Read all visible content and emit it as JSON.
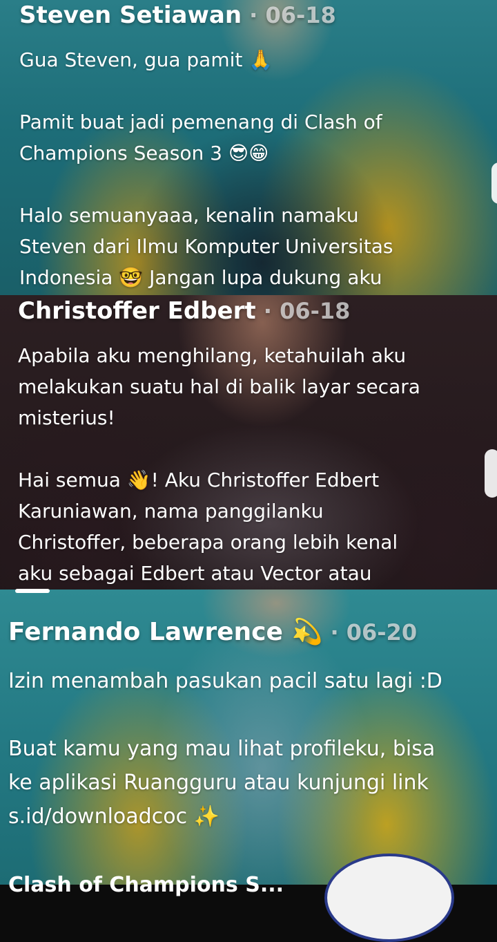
{
  "comments": [
    {
      "author": "Steven Setiawan",
      "date": "06-18",
      "paragraphs": [
        [
          "Gua Steven, gua pamit 🙏"
        ],
        [
          "Pamit buat jadi pemenang di Clash of",
          "Champions Season 3 😎😁"
        ],
        [
          "Halo semuanyaaa, kenalin namaku",
          "Steven dari Ilmu Komputer Universitas",
          "Indonesia 🤓 Jangan lupa dukung aku"
        ]
      ]
    },
    {
      "author": "Christoffer Edbert",
      "date": "06-18",
      "paragraphs": [
        [
          "Apabila aku menghilang, ketahuilah aku",
          "melakukan suatu hal di balik layar secara",
          "misterius!"
        ],
        [
          "Hai semua 👋! Aku Christoffer Edbert",
          "Karuniawan, nama panggilanku",
          "Christoffer, beberapa orang lebih kenal",
          "aku sebagai Edbert atau Vector atau"
        ]
      ]
    },
    {
      "author": "Fernando Lawrence 💫",
      "date": "06-20",
      "paragraphs": [
        [
          "Izin menambah pasukan pacil satu lagi :D"
        ],
        [
          "Buat kamu yang mau lihat profileku, bisa",
          "ke aplikasi Ruangguru atau kunjungi link",
          "s.id/downloadcoc ✨"
        ]
      ]
    }
  ],
  "separator": " · ",
  "bottom_partial_text": "Clash of Champions S...",
  "colors": {
    "text": "#ffffff",
    "date": "#e6e6e6"
  }
}
